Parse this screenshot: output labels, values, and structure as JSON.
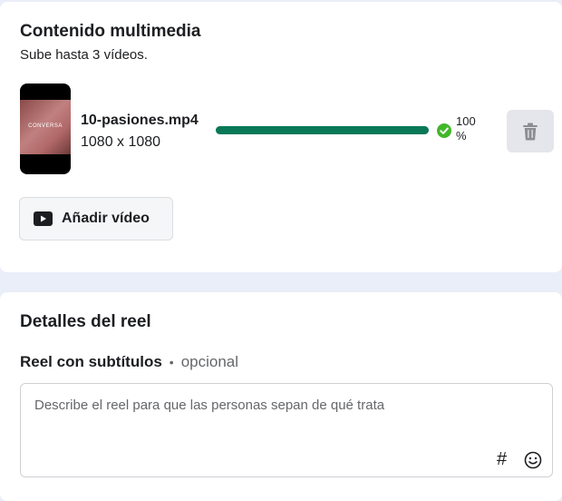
{
  "media": {
    "title": "Contenido multimedia",
    "subtitle": "Sube hasta 3 vídeos.",
    "file": {
      "name": "10-pasiones.mp4",
      "dimensions": "1080 x 1080",
      "thumbnail_text": "CONVERSA",
      "progress_percent": 100,
      "progress_label_value": "100",
      "progress_label_unit": "%"
    },
    "add_button_label": "Añadir vídeo"
  },
  "details": {
    "title": "Detalles del reel",
    "caption_label": "Reel con subtítulos",
    "caption_separator": "•",
    "caption_optional": "opcional",
    "caption_placeholder": "Describe el reel para que las personas sepan de qué trata",
    "hashtag_symbol": "#"
  },
  "colors": {
    "progress": "#097857",
    "check": "#42b72a"
  }
}
